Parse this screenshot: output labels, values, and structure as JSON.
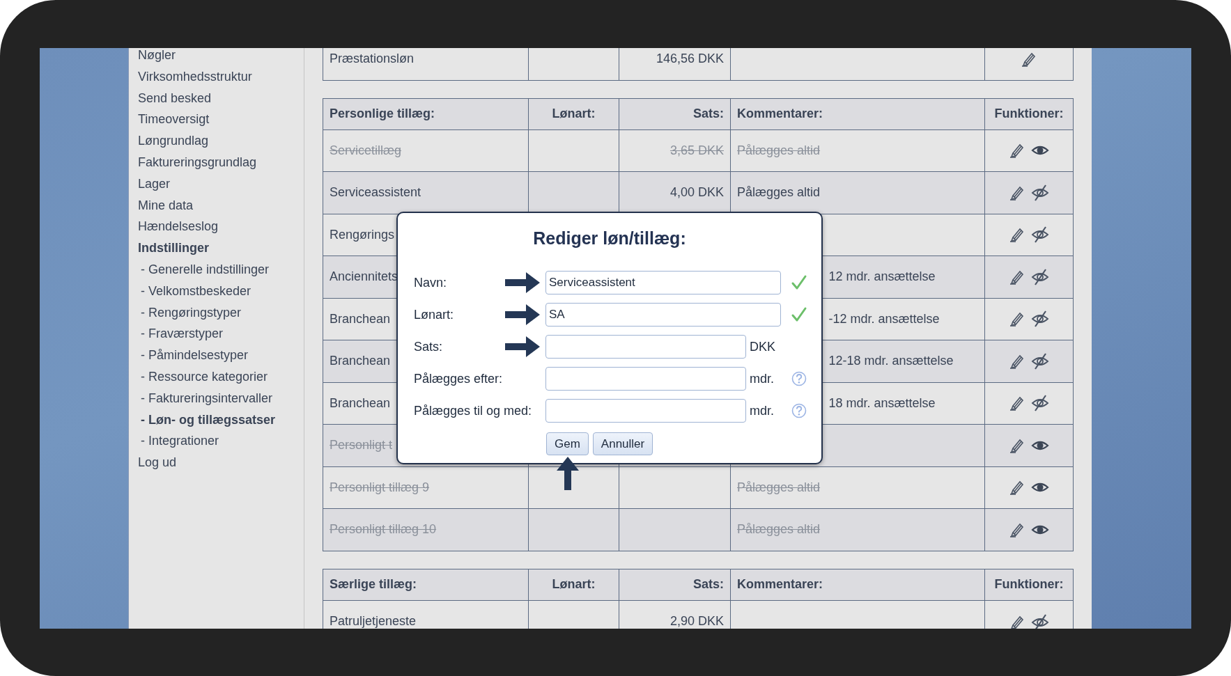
{
  "sidebar": {
    "items": [
      {
        "label": "Nøgler",
        "kind": "main",
        "selected": false
      },
      {
        "label": "Virksomhedsstruktur",
        "kind": "main",
        "selected": false
      },
      {
        "label": "Send besked",
        "kind": "main",
        "selected": false
      },
      {
        "label": "Timeoversigt",
        "kind": "main",
        "selected": false
      },
      {
        "label": "Løngrundlag",
        "kind": "main",
        "selected": false
      },
      {
        "label": "Faktureringsgrundlag",
        "kind": "main",
        "selected": false
      },
      {
        "label": "Lager",
        "kind": "main",
        "selected": false
      },
      {
        "label": "Mine data",
        "kind": "main",
        "selected": false
      },
      {
        "label": "Hændelseslog",
        "kind": "main",
        "selected": false
      },
      {
        "label": "Indstillinger",
        "kind": "main",
        "selected": true
      },
      {
        "label": "- Generelle indstillinger",
        "kind": "sub",
        "selected": false
      },
      {
        "label": "- Velkomstbeskeder",
        "kind": "sub",
        "selected": false
      },
      {
        "label": "- Rengøringstyper",
        "kind": "sub",
        "selected": false
      },
      {
        "label": "- Fraværstyper",
        "kind": "sub",
        "selected": false
      },
      {
        "label": "- Påmindelsestyper",
        "kind": "sub",
        "selected": false
      },
      {
        "label": "- Ressource kategorier",
        "kind": "sub",
        "selected": false
      },
      {
        "label": "- Faktureringsintervaller",
        "kind": "sub",
        "selected": false
      },
      {
        "label": "- Løn- og tillægssatser",
        "kind": "sub",
        "selected": true
      },
      {
        "label": "- Integrationer",
        "kind": "sub",
        "selected": false
      },
      {
        "label": "Log ud",
        "kind": "main",
        "selected": false
      }
    ]
  },
  "tables": [
    {
      "rows": [
        {
          "name": "Præstationsløn",
          "rate": "146,56 DKK"
        }
      ]
    },
    {
      "columns": [
        "Personlige tillæg:",
        "Lønart:",
        "Sats:",
        "Kommentarer:",
        "Funktioner:"
      ],
      "rows": [
        {
          "name": "Servicetillæg",
          "rate": "3,65 DKK",
          "comment": "Pålægges altid",
          "inactive": true
        },
        {
          "name": "Serviceassistent",
          "rate": "4,00 DKK",
          "comment": "Pålægges altid",
          "inactive": false
        },
        {
          "name": "Rengørings",
          "inactive": false
        },
        {
          "name": "Anciennitets",
          "comment": "12 mdr. ansættelse",
          "inactive": false
        },
        {
          "name": "Branchean",
          "comment": "-12 mdr. ansættelse",
          "inactive": false
        },
        {
          "name": "Branchean",
          "comment": "12-18 mdr. ansættelse",
          "inactive": false
        },
        {
          "name": "Branchean",
          "comment": "18 mdr. ansættelse",
          "inactive": false
        },
        {
          "name": "Personligt t",
          "inactive": true
        },
        {
          "name": "Personligt tillæg 9",
          "comment": "Pålægges altid",
          "inactive": true
        },
        {
          "name": "Personligt tillæg 10",
          "comment": "Pålægges altid",
          "inactive": true
        }
      ]
    },
    {
      "columns": [
        "Særlige tillæg:",
        "Lønart:",
        "Sats:",
        "Kommentarer:",
        "Funktioner:"
      ],
      "rows": [
        {
          "name": "Patruljetjeneste",
          "rate": "2,90 DKK",
          "inactive": false
        }
      ]
    }
  ],
  "dialog": {
    "title": "Rediger løn/tillæg:",
    "fields": [
      {
        "label": "Navn:",
        "value": "Serviceassistent",
        "valid": true,
        "help": false,
        "arrow": true
      },
      {
        "label": "Lønart:",
        "value": "SA",
        "valid": true,
        "help": false,
        "arrow": true
      },
      {
        "label": "Sats:",
        "suffix": "DKK",
        "valid": false,
        "help": false,
        "arrow": true
      },
      {
        "label": "Pålægges efter:",
        "suffix": "mdr.",
        "valid": false,
        "help": true,
        "arrow": false
      },
      {
        "label": "Pålægges til og med:",
        "suffix": "mdr.",
        "valid": false,
        "help": true,
        "arrow": false
      }
    ],
    "buttons": [
      {
        "label": "Gem",
        "arrow": true
      },
      {
        "label": "Annuller",
        "arrow": false
      }
    ]
  }
}
